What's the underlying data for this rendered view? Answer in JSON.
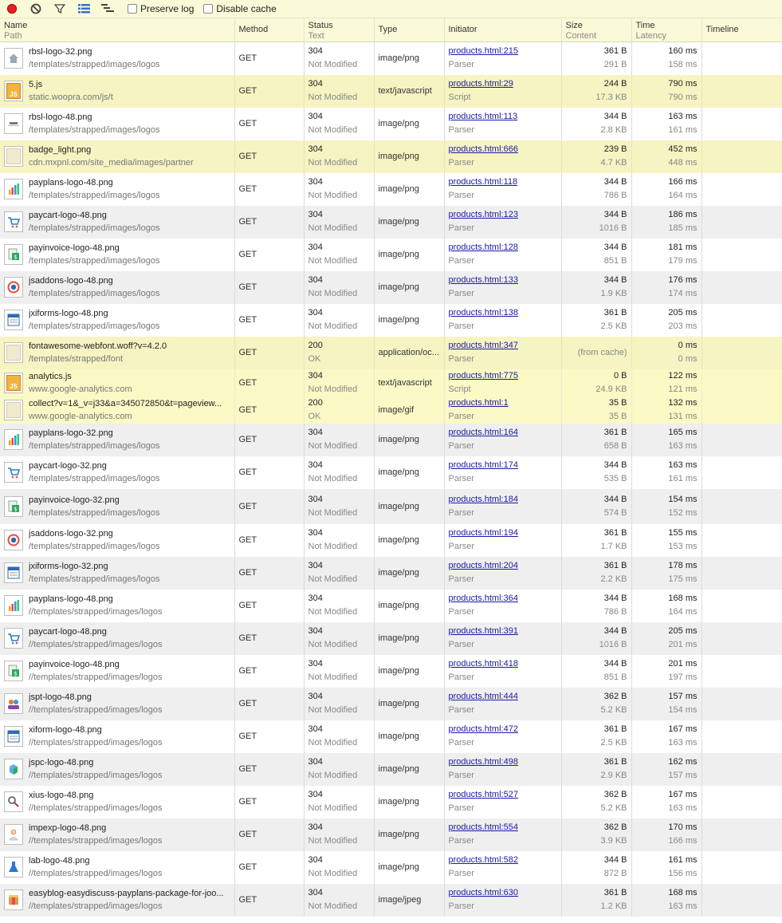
{
  "toolbar": {
    "preserve_log": "Preserve log",
    "disable_cache": "Disable cache"
  },
  "columns": {
    "name": "Name",
    "name_sub": "Path",
    "method": "Method",
    "status": "Status",
    "status_sub": "Text",
    "type": "Type",
    "initiator": "Initiator",
    "size": "Size",
    "size_sub": "Content",
    "time": "Time",
    "time_sub": "Latency",
    "timeline": "Timeline"
  },
  "rows": [
    {
      "name": "rbsl-logo-32.png",
      "path": "/templates/strapped/images/logos",
      "method": "GET",
      "status": "304",
      "status_text": "Not Modified",
      "type": "image/png",
      "initiator": "products.html:215",
      "initiator_type": "Parser",
      "size": "361 B",
      "content": "291 B",
      "time": "160 ms",
      "latency": "158 ms",
      "icon": "house-icon",
      "style": "r-white"
    },
    {
      "name": "5.js",
      "path": "static.woopra.com/js/t",
      "method": "GET",
      "status": "304",
      "status_text": "Not Modified",
      "type": "text/javascript",
      "initiator": "products.html:29",
      "initiator_type": "Script",
      "size": "244 B",
      "content": "17.3 KB",
      "time": "790 ms",
      "latency": "790 ms",
      "icon": "js-icon",
      "style": "r-yellow"
    },
    {
      "name": "rbsl-logo-48.png",
      "path": "/templates/strapped/images/logos",
      "method": "GET",
      "status": "304",
      "status_text": "Not Modified",
      "type": "image/png",
      "initiator": "products.html:113",
      "initiator_type": "Parser",
      "size": "344 B",
      "content": "2.8 KB",
      "time": "163 ms",
      "latency": "161 ms",
      "icon": "logo-icon",
      "style": "r-white"
    },
    {
      "name": "badge_light.png",
      "path": "cdn.mxpnl.com/site_media/images/partner",
      "method": "GET",
      "status": "304",
      "status_text": "Not Modified",
      "type": "image/png",
      "initiator": "products.html:666",
      "initiator_type": "Parser",
      "size": "239 B",
      "content": "4.7 KB",
      "time": "452 ms",
      "latency": "448 ms",
      "icon": "badge-icon",
      "style": "r-yellow"
    },
    {
      "name": "payplans-logo-48.png",
      "path": "/templates/strapped/images/logos",
      "method": "GET",
      "status": "304",
      "status_text": "Not Modified",
      "type": "image/png",
      "initiator": "products.html:118",
      "initiator_type": "Parser",
      "size": "344 B",
      "content": "786 B",
      "time": "166 ms",
      "latency": "164 ms",
      "icon": "bar-chart-icon",
      "style": "r-white"
    },
    {
      "name": "paycart-logo-48.png",
      "path": "/templates/strapped/images/logos",
      "method": "GET",
      "status": "304",
      "status_text": "Not Modified",
      "type": "image/png",
      "initiator": "products.html:123",
      "initiator_type": "Parser",
      "size": "344 B",
      "content": "1016 B",
      "time": "186 ms",
      "latency": "185 ms",
      "icon": "cart-icon",
      "style": "r-gray"
    },
    {
      "name": "payinvoice-logo-48.png",
      "path": "/templates/strapped/images/logos",
      "method": "GET",
      "status": "304",
      "status_text": "Not Modified",
      "type": "image/png",
      "initiator": "products.html:128",
      "initiator_type": "Parser",
      "size": "344 B",
      "content": "851 B",
      "time": "181 ms",
      "latency": "179 ms",
      "icon": "invoice-icon",
      "style": "r-white"
    },
    {
      "name": "jsaddons-logo-48.png",
      "path": "/templates/strapped/images/logos",
      "method": "GET",
      "status": "304",
      "status_text": "Not Modified",
      "type": "image/png",
      "initiator": "products.html:133",
      "initiator_type": "Parser",
      "size": "344 B",
      "content": "1.9 KB",
      "time": "176 ms",
      "latency": "174 ms",
      "icon": "addons-icon",
      "style": "r-gray"
    },
    {
      "name": "jxiforms-logo-48.png",
      "path": "/templates/strapped/images/logos",
      "method": "GET",
      "status": "304",
      "status_text": "Not Modified",
      "type": "image/png",
      "initiator": "products.html:138",
      "initiator_type": "Parser",
      "size": "361 B",
      "content": "2.5 KB",
      "time": "205 ms",
      "latency": "203 ms",
      "icon": "form-icon",
      "style": "r-white"
    },
    {
      "name": "fontawesome-webfont.woff?v=4.2.0",
      "path": "/templates/strapped/font",
      "method": "GET",
      "status": "200",
      "status_text": "OK",
      "type": "application/oc...",
      "initiator": "products.html:347",
      "initiator_type": "Parser",
      "size": "",
      "content": "",
      "cache": "(from cache)",
      "time": "0 ms",
      "latency": "0 ms",
      "icon": "file-icon",
      "style": "r-yellow"
    }
  ],
  "hilite_rows": [
    {
      "name": "analytics.js",
      "path": "www.google-analytics.com",
      "method": "GET",
      "status": "304",
      "status_text": "Not Modified",
      "type": "text/javascript",
      "initiator": "products.html:775",
      "initiator_type": "Script",
      "size": "0 B",
      "content": "24.9 KB",
      "time": "122 ms",
      "latency": "121 ms",
      "icon": "js-icon"
    },
    {
      "name": "collect?v=1&_v=j33&a=345072850&t=pageview...",
      "path": "www.google-analytics.com",
      "method": "GET",
      "status": "200",
      "status_text": "OK",
      "type": "image/gif",
      "initiator": "products.html:1",
      "initiator_type": "Parser",
      "size": "35 B",
      "content": "35 B",
      "time": "132 ms",
      "latency": "131 ms",
      "icon": "file-icon"
    }
  ],
  "rows2": [
    {
      "name": "payplans-logo-32.png",
      "path": "/templates/strapped/images/logos",
      "method": "GET",
      "status": "304",
      "status_text": "Not Modified",
      "type": "image/png",
      "initiator": "products.html:164",
      "initiator_type": "Parser",
      "size": "361 B",
      "content": "658 B",
      "time": "165 ms",
      "latency": "163 ms",
      "icon": "bar-chart-icon",
      "style": "r-gray"
    },
    {
      "name": "paycart-logo-32.png",
      "path": "/templates/strapped/images/logos",
      "method": "GET",
      "status": "304",
      "status_text": "Not Modified",
      "type": "image/png",
      "initiator": "products.html:174",
      "initiator_type": "Parser",
      "size": "344 B",
      "content": "535 B",
      "time": "163 ms",
      "latency": "161 ms",
      "icon": "cart-icon",
      "style": "r-white"
    },
    {
      "name": "payinvoice-logo-32.png",
      "path": "/templates/strapped/images/logos",
      "method": "GET",
      "status": "304",
      "status_text": "Not Modified",
      "type": "image/png",
      "initiator": "products.html:184",
      "initiator_type": "Parser",
      "size": "344 B",
      "content": "574 B",
      "time": "154 ms",
      "latency": "152 ms",
      "icon": "invoice-icon",
      "style": "r-gray"
    },
    {
      "name": "jsaddons-logo-32.png",
      "path": "/templates/strapped/images/logos",
      "method": "GET",
      "status": "304",
      "status_text": "Not Modified",
      "type": "image/png",
      "initiator": "products.html:194",
      "initiator_type": "Parser",
      "size": "361 B",
      "content": "1.7 KB",
      "time": "155 ms",
      "latency": "153 ms",
      "icon": "addons-icon",
      "style": "r-white"
    },
    {
      "name": "jxiforms-logo-32.png",
      "path": "/templates/strapped/images/logos",
      "method": "GET",
      "status": "304",
      "status_text": "Not Modified",
      "type": "image/png",
      "initiator": "products.html:204",
      "initiator_type": "Parser",
      "size": "361 B",
      "content": "2.2 KB",
      "time": "178 ms",
      "latency": "175 ms",
      "icon": "form-icon",
      "style": "r-gray"
    },
    {
      "name": "payplans-logo-48.png",
      "path": "//templates/strapped/images/logos",
      "method": "GET",
      "status": "304",
      "status_text": "Not Modified",
      "type": "image/png",
      "initiator": "products.html:364",
      "initiator_type": "Parser",
      "size": "344 B",
      "content": "786 B",
      "time": "168 ms",
      "latency": "164 ms",
      "icon": "bar-chart-icon",
      "style": "r-white"
    },
    {
      "name": "paycart-logo-48.png",
      "path": "//templates/strapped/images/logos",
      "method": "GET",
      "status": "304",
      "status_text": "Not Modified",
      "type": "image/png",
      "initiator": "products.html:391",
      "initiator_type": "Parser",
      "size": "344 B",
      "content": "1016 B",
      "time": "205 ms",
      "latency": "201 ms",
      "icon": "cart-icon",
      "style": "r-gray"
    },
    {
      "name": "payinvoice-logo-48.png",
      "path": "//templates/strapped/images/logos",
      "method": "GET",
      "status": "304",
      "status_text": "Not Modified",
      "type": "image/png",
      "initiator": "products.html:418",
      "initiator_type": "Parser",
      "size": "344 B",
      "content": "851 B",
      "time": "201 ms",
      "latency": "197 ms",
      "icon": "invoice-icon",
      "style": "r-white"
    },
    {
      "name": "jspt-logo-48.png",
      "path": "//templates/strapped/images/logos",
      "method": "GET",
      "status": "304",
      "status_text": "Not Modified",
      "type": "image/png",
      "initiator": "products.html:444",
      "initiator_type": "Parser",
      "size": "362 B",
      "content": "5.2 KB",
      "time": "157 ms",
      "latency": "154 ms",
      "icon": "users-icon",
      "style": "r-gray"
    },
    {
      "name": "xiform-logo-48.png",
      "path": "//templates/strapped/images/logos",
      "method": "GET",
      "status": "304",
      "status_text": "Not Modified",
      "type": "image/png",
      "initiator": "products.html:472",
      "initiator_type": "Parser",
      "size": "361 B",
      "content": "2.5 KB",
      "time": "167 ms",
      "latency": "163 ms",
      "icon": "form-icon",
      "style": "r-white"
    },
    {
      "name": "jspc-logo-48.png",
      "path": "//templates/strapped/images/logos",
      "method": "GET",
      "status": "304",
      "status_text": "Not Modified",
      "type": "image/png",
      "initiator": "products.html:498",
      "initiator_type": "Parser",
      "size": "361 B",
      "content": "2.9 KB",
      "time": "162 ms",
      "latency": "157 ms",
      "icon": "box-icon",
      "style": "r-gray"
    },
    {
      "name": "xius-logo-48.png",
      "path": "//templates/strapped/images/logos",
      "method": "GET",
      "status": "304",
      "status_text": "Not Modified",
      "type": "image/png",
      "initiator": "products.html:527",
      "initiator_type": "Parser",
      "size": "362 B",
      "content": "5.2 KB",
      "time": "167 ms",
      "latency": "163 ms",
      "icon": "search-user-icon",
      "style": "r-white"
    },
    {
      "name": "impexp-logo-48.png",
      "path": "//templates/strapped/images/logos",
      "method": "GET",
      "status": "304",
      "status_text": "Not Modified",
      "type": "image/png",
      "initiator": "products.html:554",
      "initiator_type": "Parser",
      "size": "362 B",
      "content": "3.9 KB",
      "time": "170 ms",
      "latency": "166 ms",
      "icon": "person-icon",
      "style": "r-gray"
    },
    {
      "name": "lab-logo-48.png",
      "path": "//templates/strapped/images/logos",
      "method": "GET",
      "status": "304",
      "status_text": "Not Modified",
      "type": "image/png",
      "initiator": "products.html:582",
      "initiator_type": "Parser",
      "size": "344 B",
      "content": "872 B",
      "time": "161 ms",
      "latency": "156 ms",
      "icon": "flask-icon",
      "style": "r-white"
    },
    {
      "name": "easyblog-easydiscuss-payplans-package-for-joo...",
      "path": "//templates/strapped/images/logos",
      "method": "GET",
      "status": "304",
      "status_text": "Not Modified",
      "type": "image/jpeg",
      "initiator": "products.html:630",
      "initiator_type": "Parser",
      "size": "361 B",
      "content": "1.2 KB",
      "time": "168 ms",
      "latency": "163 ms",
      "icon": "package-icon",
      "style": "r-gray"
    }
  ]
}
